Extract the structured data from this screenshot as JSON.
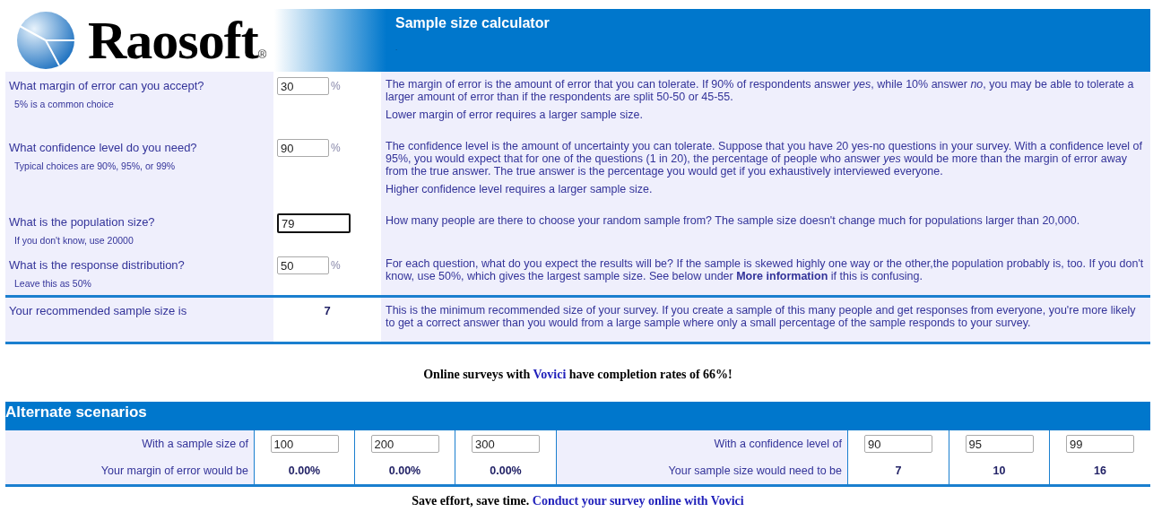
{
  "header": {
    "brand": "Raosoft",
    "registered": "®",
    "title": "Sample size calculator",
    "dot": "."
  },
  "questions": [
    {
      "question": "What margin of error can you accept?",
      "hint": "5% is a common choice",
      "value": "30",
      "unit": "%",
      "focused": false,
      "description": [
        "The margin of error is the amount of error that you can tolerate. If 90% of respondents answer *yes*, while 10% answer *no*, you may be able to tolerate a larger amount of error than if the respondents are split 50-50 or 45-55.",
        "Lower margin of error requires a larger sample size."
      ]
    },
    {
      "question": "What confidence level do you need?",
      "hint": "Typical choices are 90%, 95%, or 99%",
      "value": "90",
      "unit": "%",
      "focused": false,
      "description": [
        "The confidence level is the amount of uncertainty you can tolerate. Suppose that you have 20 yes-no questions in your survey. With a confidence level of 95%, you would expect that for one of the questions (1 in 20), the percentage of people who answer *yes* would be more than the margin of error away from the true answer. The true answer is the percentage you would get if you exhaustively interviewed everyone.",
        "Higher confidence level requires a larger sample size."
      ]
    },
    {
      "question": "What is the population size?",
      "hint": "If you don't know, use 20000",
      "value": "79",
      "focused": true,
      "description": [
        "How many people are there to choose your random sample from? The sample size doesn't change much for populations larger than 20,000."
      ]
    },
    {
      "question": "What is the response distribution?",
      "hint": "Leave this as 50%",
      "value": "50",
      "unit": "%",
      "focused": false,
      "description": [
        "For each question, what do you expect the results will be? If the sample is skewed highly one way or the other,the population probably is, too. If you don't know, use 50%, which gives the largest sample size. See below under **More information** if this is confusing."
      ]
    }
  ],
  "result": {
    "label": "Your recommended sample size is",
    "value": "7",
    "description": "This is the minimum recommended size of your survey. If you create a sample of this many people and get responses from everyone, you're more likely to get a correct answer than you would from a large sample where only a small percentage of the sample responds to your survey."
  },
  "promo": {
    "before": "Online surveys with",
    "link": "Vovici",
    "after": "have completion rates of 66%!"
  },
  "alternate": {
    "title": "Alternate scenarios",
    "sample_label": "With a sample size of",
    "margin_label": "Your margin of error would be",
    "sample_sizes": [
      "100",
      "200",
      "300"
    ],
    "margins": [
      "0.00%",
      "0.00%",
      "0.00%"
    ],
    "confidence_label": "With a confidence level of",
    "need_label": "Your sample size would need to be",
    "confidence_levels": [
      "90",
      "95",
      "99"
    ],
    "needed_sizes": [
      "7",
      "10",
      "16"
    ]
  },
  "footer_promo": {
    "text": "Save effort, save time.",
    "link": "Conduct your survey online with Vovici"
  }
}
